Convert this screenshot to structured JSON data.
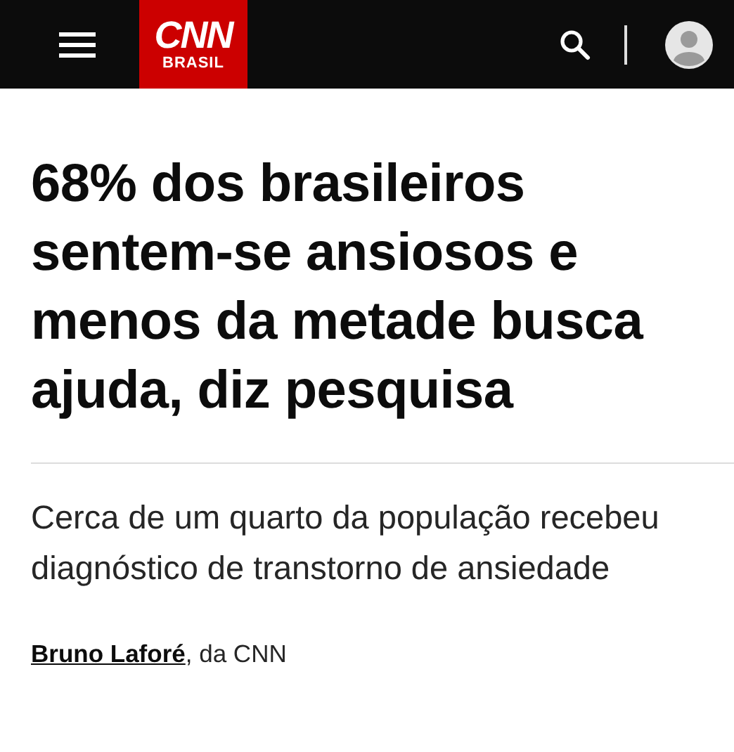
{
  "header": {
    "logo": {
      "wordmark": "CNN",
      "edition": "BRASIL"
    }
  },
  "article": {
    "headline": "68% dos brasileiros sentem-se ansiosos e menos da metade busca ajuda, diz pesquisa",
    "subheadline": "Cerca de um quarto da população recebeu diagnóstico de transtorno de ansiedade",
    "byline": {
      "author": "Bruno Laforé",
      "suffix": ", da CNN"
    }
  }
}
